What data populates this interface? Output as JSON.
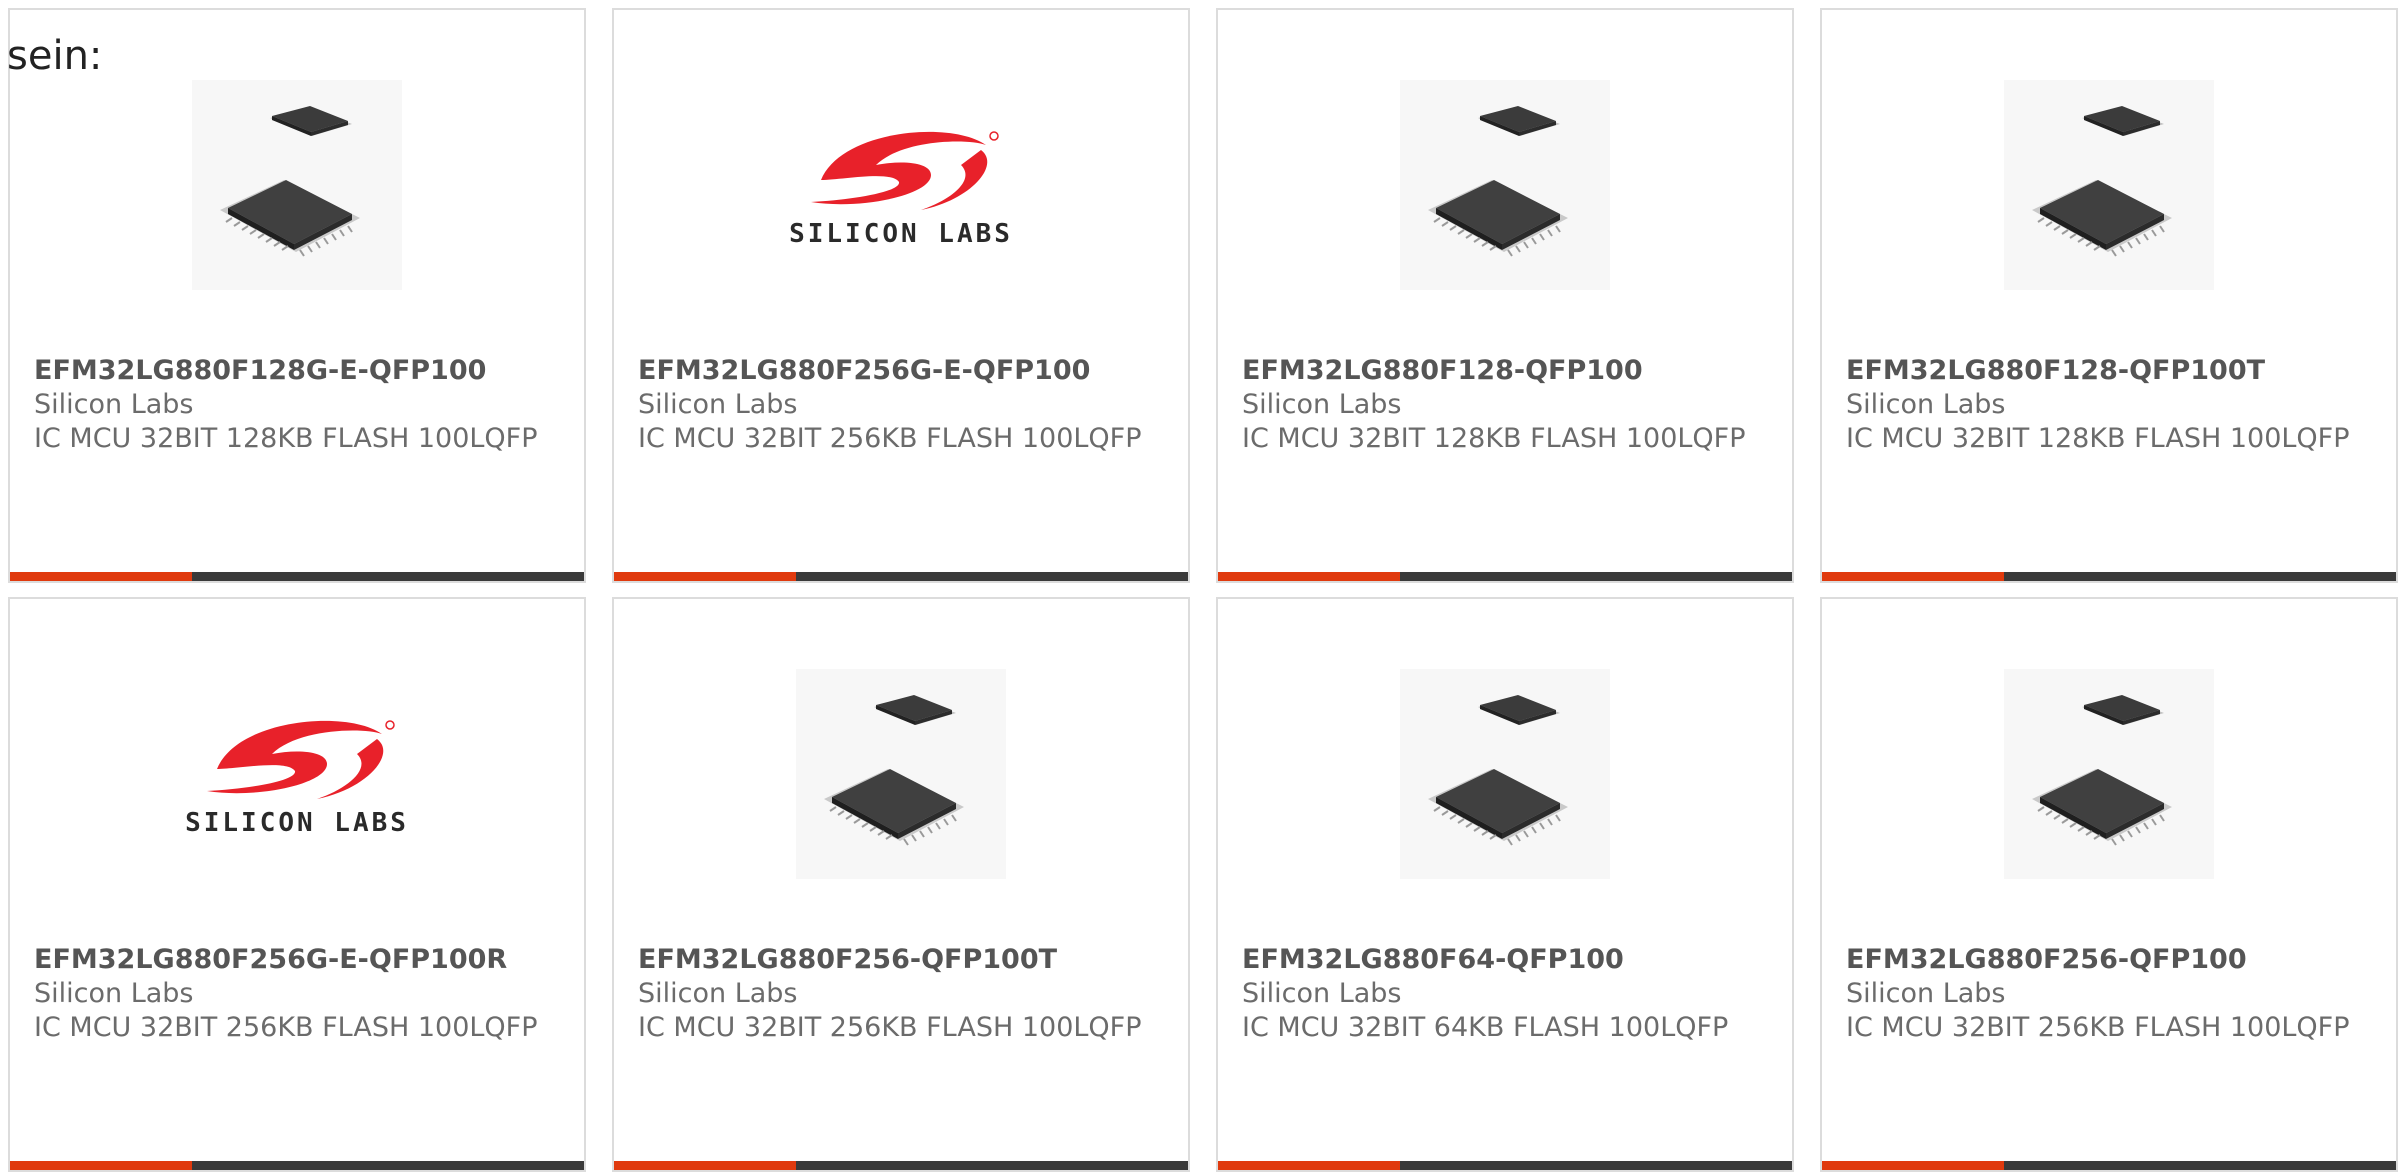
{
  "intro_text": "sein:",
  "colors": {
    "accent": "#e03a0e",
    "bar": "#3a3a3a",
    "logo_red": "#e8212a"
  },
  "products": [
    {
      "part_number": "EFM32LG880F128G-E-QFP100",
      "manufacturer": "Silicon Labs",
      "description": "IC MCU 32BIT 128KB FLASH 100LQFP",
      "image": "chip-icon"
    },
    {
      "part_number": "EFM32LG880F256G-E-QFP100",
      "manufacturer": "Silicon Labs",
      "description": "IC MCU 32BIT 256KB FLASH 100LQFP",
      "image": "silicon-labs-logo",
      "logo_text": "SILICON LABS"
    },
    {
      "part_number": "EFM32LG880F128-QFP100",
      "manufacturer": "Silicon Labs",
      "description": "IC MCU 32BIT 128KB FLASH 100LQFP",
      "image": "chip-icon"
    },
    {
      "part_number": "EFM32LG880F128-QFP100T",
      "manufacturer": "Silicon Labs",
      "description": "IC MCU 32BIT 128KB FLASH 100LQFP",
      "image": "chip-icon"
    },
    {
      "part_number": "EFM32LG880F256G-E-QFP100R",
      "manufacturer": "Silicon Labs",
      "description": "IC MCU 32BIT 256KB FLASH 100LQFP",
      "image": "silicon-labs-logo",
      "logo_text": "SILICON LABS"
    },
    {
      "part_number": "EFM32LG880F256-QFP100T",
      "manufacturer": "Silicon Labs",
      "description": "IC MCU 32BIT 256KB FLASH 100LQFP",
      "image": "chip-icon"
    },
    {
      "part_number": "EFM32LG880F64-QFP100",
      "manufacturer": "Silicon Labs",
      "description": "IC MCU 32BIT 64KB FLASH 100LQFP",
      "image": "chip-icon"
    },
    {
      "part_number": "EFM32LG880F256-QFP100",
      "manufacturer": "Silicon Labs",
      "description": "IC MCU 32BIT 256KB FLASH 100LQFP",
      "image": "chip-icon"
    }
  ]
}
